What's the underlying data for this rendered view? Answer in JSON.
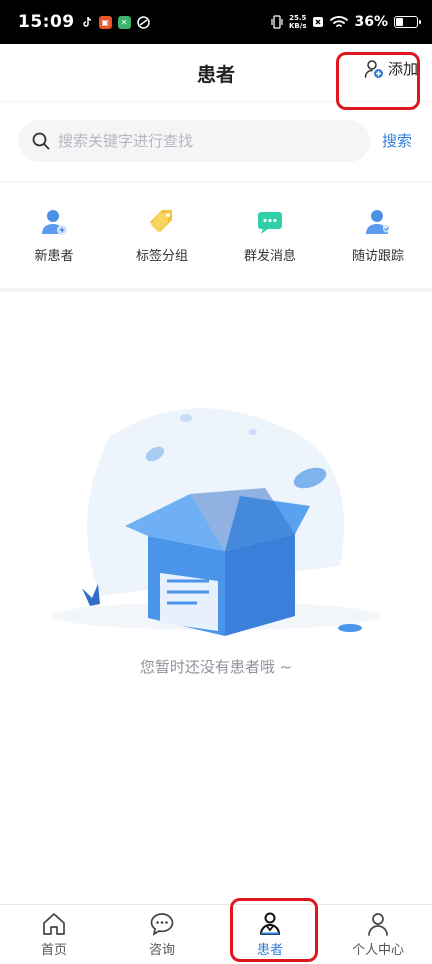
{
  "status_bar": {
    "time": "15:09",
    "speed_value": "25.5",
    "speed_unit": "KB/s",
    "battery": "36%",
    "battery_level": 0.36
  },
  "header": {
    "title": "患者",
    "add_label": "添加"
  },
  "search": {
    "placeholder": "搜索关键字进行查找",
    "button_label": "搜索"
  },
  "actions": [
    {
      "label": "新患者",
      "icon": "new-patient-icon"
    },
    {
      "label": "标签分组",
      "icon": "tag-icon"
    },
    {
      "label": "群发消息",
      "icon": "message-icon"
    },
    {
      "label": "随访跟踪",
      "icon": "follow-up-icon"
    }
  ],
  "empty_state": {
    "message": "您暂时还没有患者哦 ~"
  },
  "tabbar": [
    {
      "label": "首页",
      "icon": "home-icon",
      "active": false
    },
    {
      "label": "咨询",
      "icon": "chat-icon",
      "active": false
    },
    {
      "label": "患者",
      "icon": "patient-icon",
      "active": true
    },
    {
      "label": "个人中心",
      "icon": "profile-icon",
      "active": false
    }
  ],
  "colors": {
    "accent": "#2f7fd8",
    "annotation": "#e0161f",
    "search_bg": "#f4f5f7"
  }
}
